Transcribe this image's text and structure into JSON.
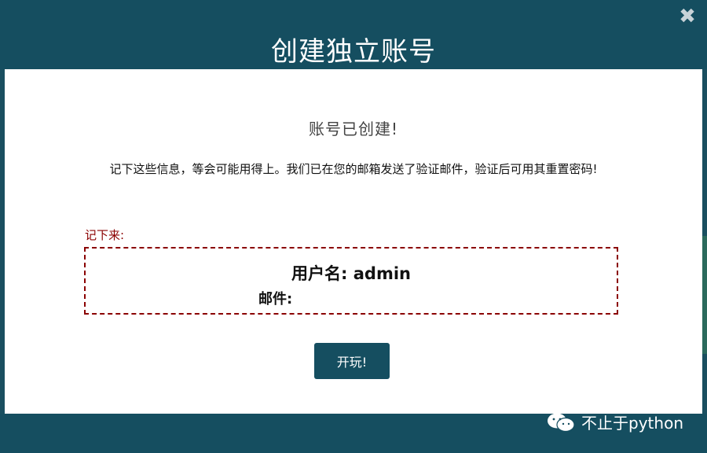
{
  "modal": {
    "title": "创建独立账号",
    "close_icon": "close-icon"
  },
  "content": {
    "subtitle": "账号已创建!",
    "message": "记下这些信息，等会可能用得上。我们已在您的邮箱发送了验证邮件，验证后可用其重置密码!",
    "note_label": "记下来:",
    "username_label": "用户名:",
    "username_value": "admin",
    "email_label": "邮件:",
    "email_value": ""
  },
  "actions": {
    "play_button_label": "开玩!"
  },
  "watermark": {
    "text": "不止于python",
    "icon": "wechat-icon"
  },
  "colors": {
    "header": "#154e60",
    "accent_red": "#8b0000",
    "button": "#154e60"
  }
}
